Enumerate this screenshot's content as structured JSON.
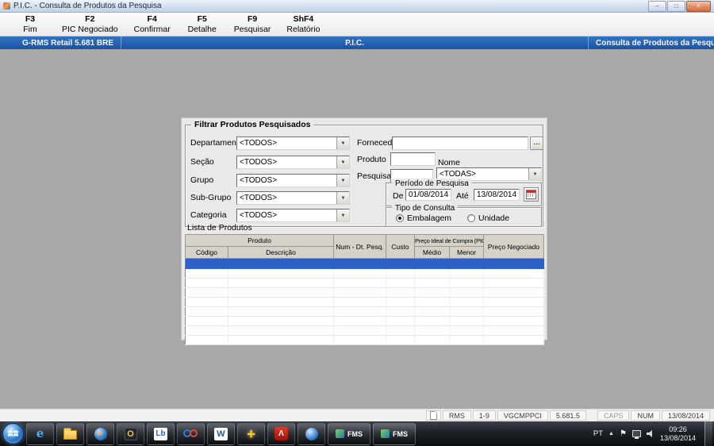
{
  "window": {
    "title": "P.I.C. - Consulta de Produtos da Pesquisa",
    "controls": {
      "minimize": "–",
      "maximize": "□",
      "close": "×"
    }
  },
  "toolbar": {
    "items": [
      {
        "key": "F3",
        "label": "Fim"
      },
      {
        "key": "F2",
        "label": "PIC Negociado"
      },
      {
        "key": "F4",
        "label": "Confirmar"
      },
      {
        "key": "F5",
        "label": "Detalhe"
      },
      {
        "key": "F9",
        "label": "Pesquisar"
      },
      {
        "key": "ShF4",
        "label": "Relatório"
      }
    ]
  },
  "header": {
    "left": "G-RMS Retail 5.681 BRE",
    "center": "P.I.C.",
    "right": "Consulta de Produtos da Pesquisa"
  },
  "filter": {
    "title": "Filtrar Produtos Pesquisados",
    "combos": [
      {
        "label": "Departamento",
        "value": "<TODOS>"
      },
      {
        "label": "Seção",
        "value": "<TODOS>"
      },
      {
        "label": "Grupo",
        "value": "<TODOS>"
      },
      {
        "label": "Sub-Grupo",
        "value": "<TODOS>"
      },
      {
        "label": "Categoria",
        "value": "<TODOS>"
      }
    ],
    "fornecedor_label": "Fornecedor",
    "browse_label": "...",
    "produto_label": "Produto",
    "pesquisa_label": "Pesquisa",
    "nome_label": "Nome",
    "nome_value": "<TODAS>",
    "periodo": {
      "title": "Período de Pesquisa",
      "de_label": "De",
      "de_value": "01/08/2014",
      "ate_label": "Até",
      "ate_value": "13/08/2014"
    },
    "tipo": {
      "title": "Tipo de Consulta",
      "embalagem": "Embalagem",
      "unidade": "Unidade"
    }
  },
  "list": {
    "title": "Lista de Produtos",
    "headers": {
      "produto": "Produto",
      "codigo": "Código",
      "descricao": "Descrição",
      "num_dt": "Num - Dt. Pesq.",
      "custo": "Custo",
      "pic": "Preço Ideal de Compra (PIC)",
      "medio": "Médio",
      "menor": "Menor",
      "preco_negociado": "Preço Negociado"
    }
  },
  "statusbar": {
    "items": [
      "RMS",
      "1-9",
      "VGCMPPCI",
      "5.681.5"
    ],
    "caps": "CAPS",
    "num": "NUM",
    "date": "13/08/2014"
  },
  "taskbar": {
    "language": "PT",
    "icons": {
      "ie": "e",
      "media_play": "▶",
      "outlook": "O",
      "lb": "Lb",
      "word": "W",
      "plus": "+",
      "adobe": "Λ",
      "chevron_up": "▲",
      "flag": "⚑"
    },
    "buttons": [
      {
        "label": "FMS"
      },
      {
        "label": "FMS"
      }
    ],
    "clock": {
      "time": "09:26",
      "date": "13/08/2014"
    }
  },
  "icons": {
    "chevron_down": "▼"
  },
  "colors": {
    "header_blue": "#1f5aa8",
    "selection_blue": "#2d61c8",
    "client_gray": "#a8a8a8"
  }
}
